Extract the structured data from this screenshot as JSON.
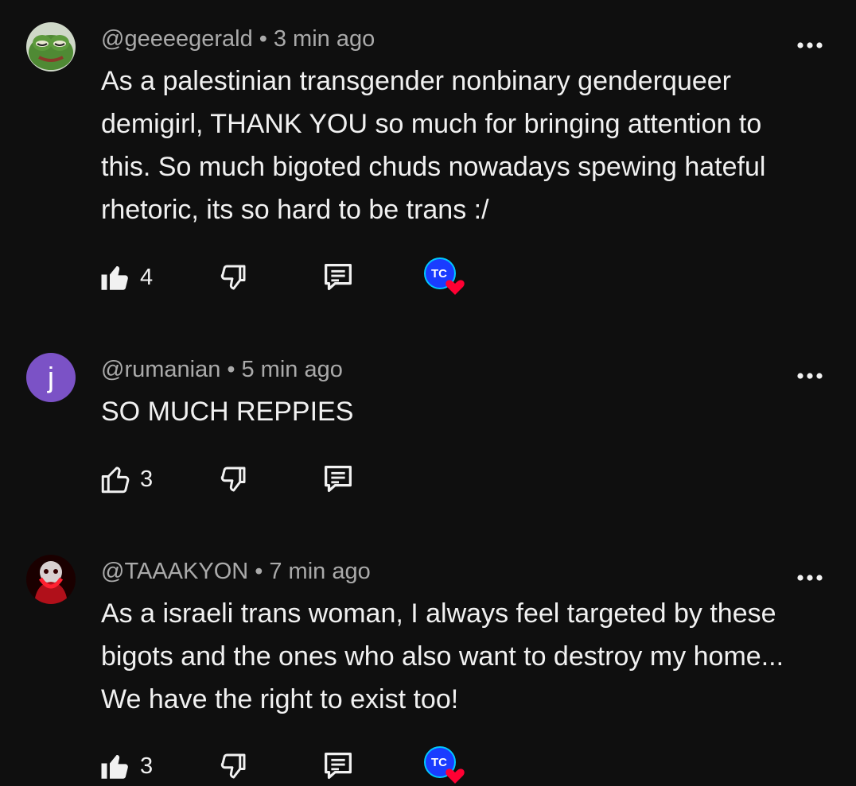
{
  "comments": [
    {
      "username": "@geeeegerald",
      "separator": "•",
      "time": "3 min ago",
      "text": "As a palestinian transgender nonbinary genderqueer demigirl, THANK YOU so much for bringing attention to this. So much bigoted chuds nowadays spewing hateful rhetoric, its so hard to be trans :/",
      "like_count": "4",
      "liked": true,
      "creator_heart": true,
      "avatar": "frog-avatar"
    },
    {
      "username": "@rumanian",
      "separator": "•",
      "time": "5 min ago",
      "text": "SO MUCH REPPIES",
      "like_count": "3",
      "liked": false,
      "creator_heart": false,
      "avatar_letter": "j",
      "avatar_color": "#7b52c6"
    },
    {
      "username": "@TAAAKYON",
      "separator": "•",
      "time": "7 min ago",
      "text": "As a israeli trans woman, I always feel targeted by these bigots and the ones who also want to destroy my home... We have the right to exist too!",
      "like_count": "3",
      "liked": true,
      "creator_heart": true,
      "avatar": "red-figure-avatar"
    }
  ],
  "colors": {
    "background": "#0f0f0f",
    "text": "#f1f1f1",
    "meta": "#aaaaaa",
    "heart": "#ff0033",
    "creator_avatar": "#1a3cff"
  }
}
